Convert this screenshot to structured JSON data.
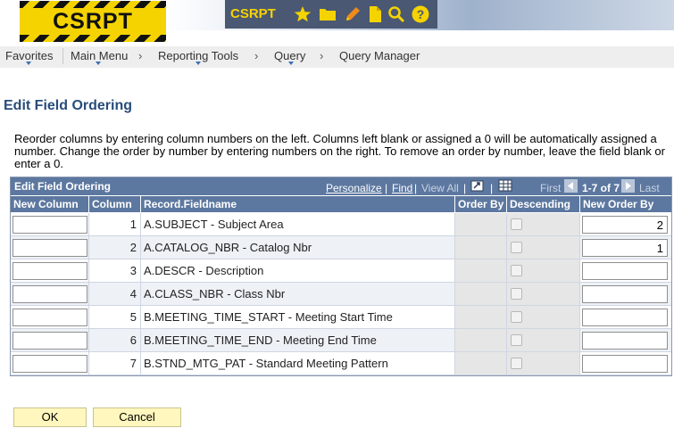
{
  "app": {
    "title": "CSRPT",
    "banner_logo": "CSRPT"
  },
  "header_icons": [
    "star-icon",
    "folder-icon",
    "pencil-icon",
    "document-icon",
    "search-icon",
    "help-icon"
  ],
  "nav": {
    "favorites": "Favorites",
    "main_menu": "Main Menu",
    "reporting_tools": "Reporting Tools",
    "query": "Query",
    "query_manager": "Query Manager",
    "sep": "›"
  },
  "page": {
    "title": "Edit Field Ordering",
    "instructions": "Reorder columns by entering column numbers on the left. Columns left blank or assigned a 0 will be automatically assigned a number. Change the order by number by entering numbers on the right. To remove an order by number, leave the field blank or enter a 0."
  },
  "grid": {
    "title": "Edit Field Ordering",
    "personalize": "Personalize",
    "pipe": "|",
    "find": "Find",
    "view_all": "View All",
    "first": "First",
    "range": "1-7 of 7",
    "last": "Last",
    "columns": [
      "New Column",
      "Column",
      "Record.Fieldname",
      "Order By",
      "Descending",
      "New Order By"
    ],
    "rows": [
      {
        "new_column": "",
        "column": "1",
        "fieldname": "A.SUBJECT - Subject Area",
        "new_order_by": "2"
      },
      {
        "new_column": "",
        "column": "2",
        "fieldname": "A.CATALOG_NBR - Catalog Nbr",
        "new_order_by": "1"
      },
      {
        "new_column": "",
        "column": "3",
        "fieldname": "A.DESCR - Description",
        "new_order_by": ""
      },
      {
        "new_column": "",
        "column": "4",
        "fieldname": "A.CLASS_NBR - Class Nbr",
        "new_order_by": ""
      },
      {
        "new_column": "",
        "column": "5",
        "fieldname": "B.MEETING_TIME_START - Meeting Start Time",
        "new_order_by": ""
      },
      {
        "new_column": "",
        "column": "6",
        "fieldname": "B.MEETING_TIME_END - Meeting End Time",
        "new_order_by": ""
      },
      {
        "new_column": "",
        "column": "7",
        "fieldname": "B.STND_MTG_PAT - Standard Meeting Pattern",
        "new_order_by": ""
      }
    ]
  },
  "buttons": {
    "ok": "OK",
    "cancel": "Cancel"
  },
  "colors": {
    "grid_header": "#5d78a0",
    "button_bg": "#fff7bd",
    "title_color": "#284c7a",
    "logo_yellow": "#f5d300"
  }
}
